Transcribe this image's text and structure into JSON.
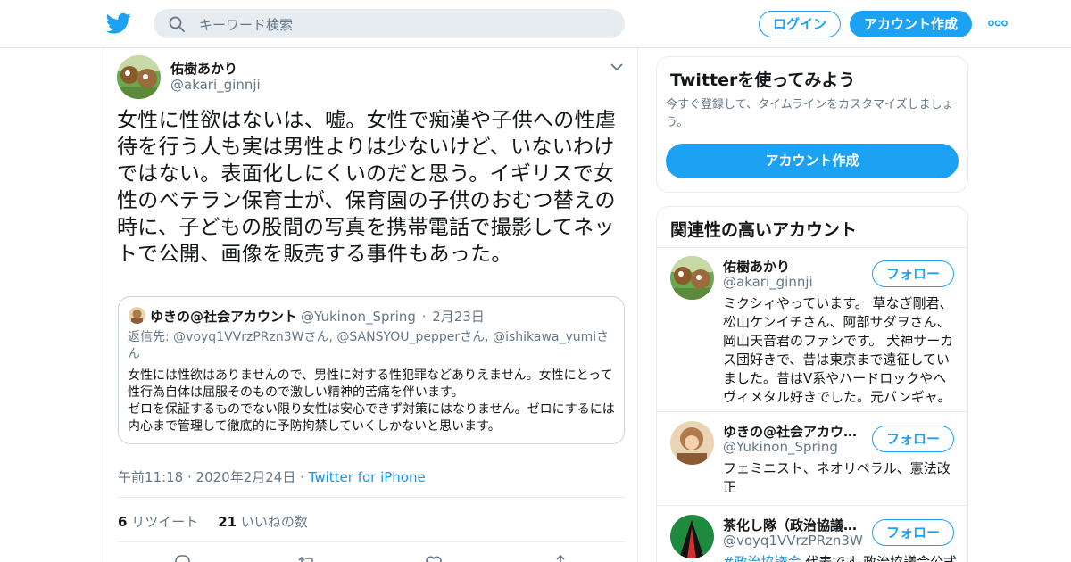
{
  "header": {
    "search_placeholder": "キーワード検索",
    "login_label": "ログイン",
    "signup_label": "アカウント作成",
    "logo_icon": "twitter-bird-icon",
    "brand_color": "#1da1f2"
  },
  "tweet": {
    "author_name": "佑樹あかり",
    "author_handle": "@akari_ginnji",
    "text": "女性に性欲はないは、嘘。女性で痴漢や子供への性虐待を行う人も実は男性よりは少ないけど、いないわけではない。表面化しにくいのだと思う。イギリスで女性のベテラン保育士が、保育園の子供のおむつ替えの時に、子どもの股間の写真を携帯電話で撮影してネットで公開、画像を販売する事件もあった。",
    "quote": {
      "name": "ゆきの@社会アカウント",
      "handle": "@Yukinon_Spring",
      "date": "2月23日",
      "reply_prefix": "返信先: ",
      "reply_to": "@voyq1VVrzPRzn3Wさん, @SANSYOU_pepperさん, @ishikawa_yumiさん",
      "body": "女性には性欲はありませんので、男性に対する性犯罪などありえません。女性にとって性行為自体は屈服そのもので激しい精神的苦痛を伴います。\nゼロを保証するものでない限り女性は安心できず対策にはなりません。ゼロにするには内心まで管理して徹底的に予防拘禁していくしかないと思います。"
    },
    "timestamp": "午前11:18 · 2020年2月24日",
    "source_sep": " · ",
    "source": "Twitter for iPhone",
    "retweet_count": "6",
    "retweet_label": " リツイート",
    "like_count": "21",
    "like_label": " いいねの数"
  },
  "sidebar": {
    "promo_title": "Twitterを使ってみよう",
    "promo_text": "今すぐ登録して、タイムラインをカスタマイズしましょう。",
    "promo_button": "アカウント作成",
    "related_title": "関連性の高いアカウント",
    "follow_label": "フォロー",
    "accounts": [
      {
        "name": "佑樹あかり",
        "handle": "@akari_ginnji",
        "bio": "ミクシィやっています。 草なぎ剛君、松山ケンイチさん、阿部サダヲさん、岡山天音君のファンです。 犬神サーカス団好きで、昔は東京まで遠征していました。昔はV系やハードロックやヘヴィメタル好きでした。元バンギャ。"
      },
      {
        "name": "ゆきの@社会アカウ…",
        "handle": "@Yukinon_Spring",
        "bio": "フェミニスト、ネオリベラル、憲法改正"
      },
      {
        "name": "茶化し隊（政治協議…",
        "handle": "@voyq1VVrzPRzn3W",
        "bio_tag": "#政治協議会",
        "bio_rest": " 代表です 政治協議会公式"
      }
    ]
  }
}
